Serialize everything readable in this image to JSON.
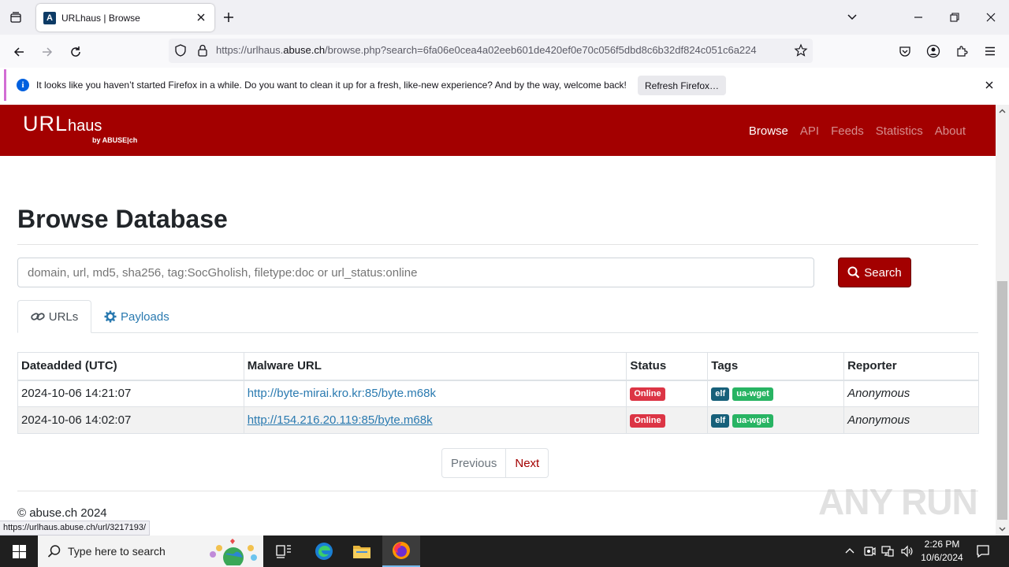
{
  "browser": {
    "tab_title": "URLhaus | Browse",
    "url_prefix": "https://urlhaus.",
    "url_domain": "abuse.ch",
    "url_rest": "/browse.php?search=6fa06e0cea4a02eeb601de420ef0e70c056f5dbd8c6b32df824c051c6a224",
    "notification": {
      "message": "It looks like you haven’t started Firefox in a while. Do you want to clean it up for a fresh, like-new experience? And by the way, welcome back!",
      "button": "Refresh Firefox…"
    },
    "status_link": "https://urlhaus.abuse.ch/url/3217193/"
  },
  "site": {
    "logo_main": "URL",
    "logo_haus": "haus",
    "logo_sub": "by ABUSE|ch",
    "nav": [
      "Browse",
      "API",
      "Feeds",
      "Statistics",
      "About"
    ],
    "active_nav": "Browse",
    "brand_color": "#a30000"
  },
  "page": {
    "title": "Browse Database",
    "search_placeholder": "domain, url, md5, sha256, tag:SocGholish, filetype:doc or url_status:online",
    "search_button": "Search",
    "tabs": {
      "urls": "URLs",
      "payloads": "Payloads"
    },
    "table": {
      "headers": [
        "Dateadded (UTC)",
        "Malware URL",
        "Status",
        "Tags",
        "Reporter"
      ],
      "rows": [
        {
          "date": "2024-10-06 14:21:07",
          "url": "http://byte-mirai.kro.kr:85/byte.m68k",
          "status": "Online",
          "tags": [
            "elf",
            "ua-wget"
          ],
          "reporter": "Anonymous"
        },
        {
          "date": "2024-10-06 14:02:07",
          "url": "http://154.216.20.119:85/byte.m68k",
          "status": "Online",
          "tags": [
            "elf",
            "ua-wget"
          ],
          "reporter": "Anonymous"
        }
      ]
    },
    "pager": {
      "previous": "Previous",
      "next": "Next"
    },
    "footer": "© abuse.ch 2024"
  },
  "watermark": "ANY RUN",
  "taskbar": {
    "search_placeholder": "Type here to search",
    "time": "2:26 PM",
    "date": "10/6/2024"
  }
}
